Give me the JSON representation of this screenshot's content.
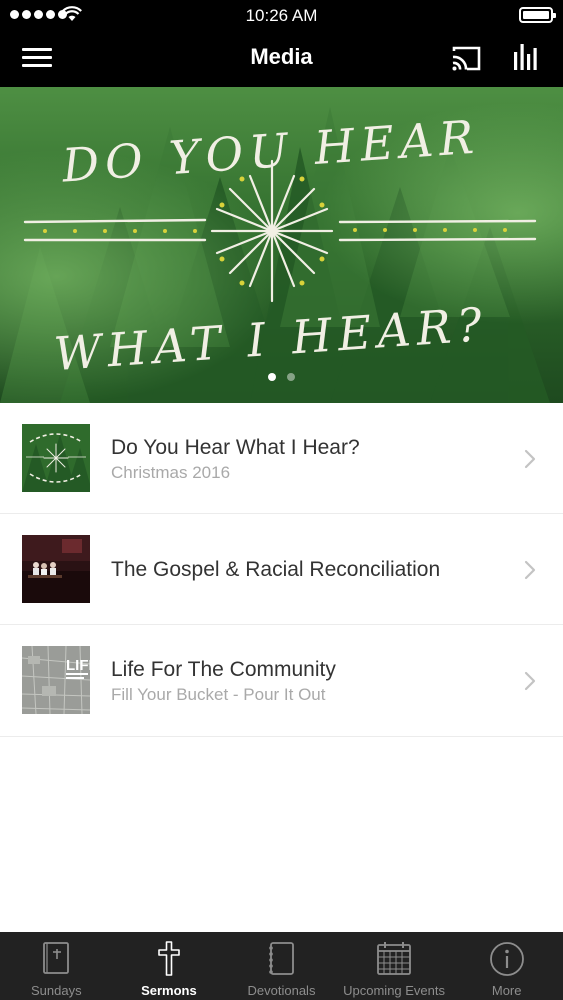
{
  "status_bar": {
    "time": "10:26 AM"
  },
  "nav": {
    "title": "Media"
  },
  "hero": {
    "artwork_text": [
      "DO YOU HEAR",
      "WHAT I HEAR?"
    ],
    "page_count": 2,
    "active_page": 1
  },
  "sermons": [
    {
      "title": "Do You Hear What I Hear?",
      "subtitle": "Christmas 2016",
      "thumbnail": "green-forest-artwork"
    },
    {
      "title": "The Gospel & Racial Reconciliation",
      "subtitle": "",
      "thumbnail": "stage-photo"
    },
    {
      "title": "Life For The Community",
      "subtitle": "Fill Your Bucket - Pour It Out",
      "thumbnail": "life-map-artwork",
      "thumbnail_text": "LIFE"
    }
  ],
  "tabs": [
    {
      "label": "Sundays",
      "icon": "bible-icon",
      "active": false
    },
    {
      "label": "Sermons",
      "icon": "cross-icon",
      "active": true
    },
    {
      "label": "Devotionals",
      "icon": "notebook-icon",
      "active": false
    },
    {
      "label": "Upcoming Events",
      "icon": "calendar-icon",
      "active": false
    },
    {
      "label": "More",
      "icon": "info-icon",
      "active": false
    }
  ],
  "colors": {
    "bar_background": "#000000",
    "tab_bar_background": "#222222",
    "forest_green": "#2f6b2c",
    "accent_yellow": "#d9d23a",
    "title_text": "#333333",
    "subtitle_text": "#a9a9a9"
  }
}
